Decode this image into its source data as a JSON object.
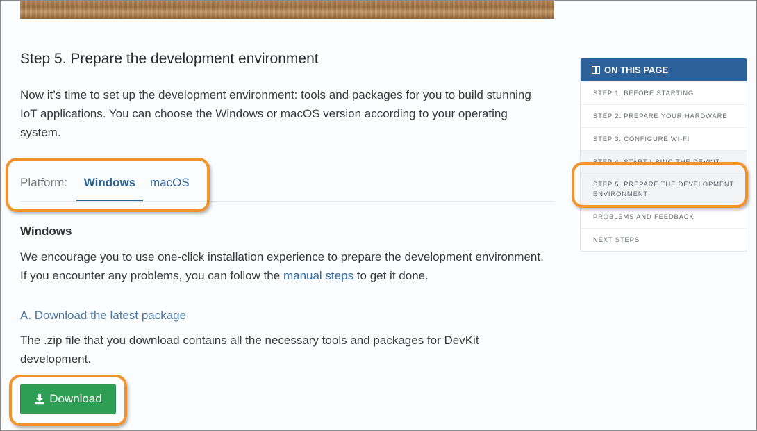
{
  "heading": "Step 5. Prepare the development environment",
  "intro": "Now it’s time to set up the development environment: tools and packages for you to build stunning IoT applications. You can choose the Windows or macOS version according to your operating system.",
  "platform": {
    "label": "Platform:",
    "tabs": [
      "Windows",
      "macOS"
    ],
    "selected": "Windows"
  },
  "windows_section": {
    "title": "Windows",
    "para_before_link": "We encourage you to use one-click installation experience to prepare the development environment. If you encounter any problems, you can follow the ",
    "link": "manual steps",
    "para_after_link": " to get it done."
  },
  "download_section": {
    "title": "A. Download the latest package",
    "text": "The .zip file that you download contains all the necessary tools and packages for DevKit development.",
    "button": "Download"
  },
  "toc": {
    "title": "ON THIS PAGE",
    "items": [
      "STEP 1. BEFORE STARTING",
      "STEP 2. PREPARE YOUR HARDWARE",
      "STEP 3. CONFIGURE WI-FI",
      "STEP 4. START USING THE DEVKIT",
      "STEP 5. PREPARE THE DEVELOPMENT ENVIRONMENT",
      "PROBLEMS AND FEEDBACK",
      "NEXT STEPS"
    ],
    "current_item": "STEP 5. PREPARE THE DEVELOPMENT ENVIRONMENT"
  },
  "colors": {
    "accent": "#2d6199",
    "link": "#2e6ca8",
    "button": "#2f9e55",
    "highlight": "#f0932b"
  }
}
